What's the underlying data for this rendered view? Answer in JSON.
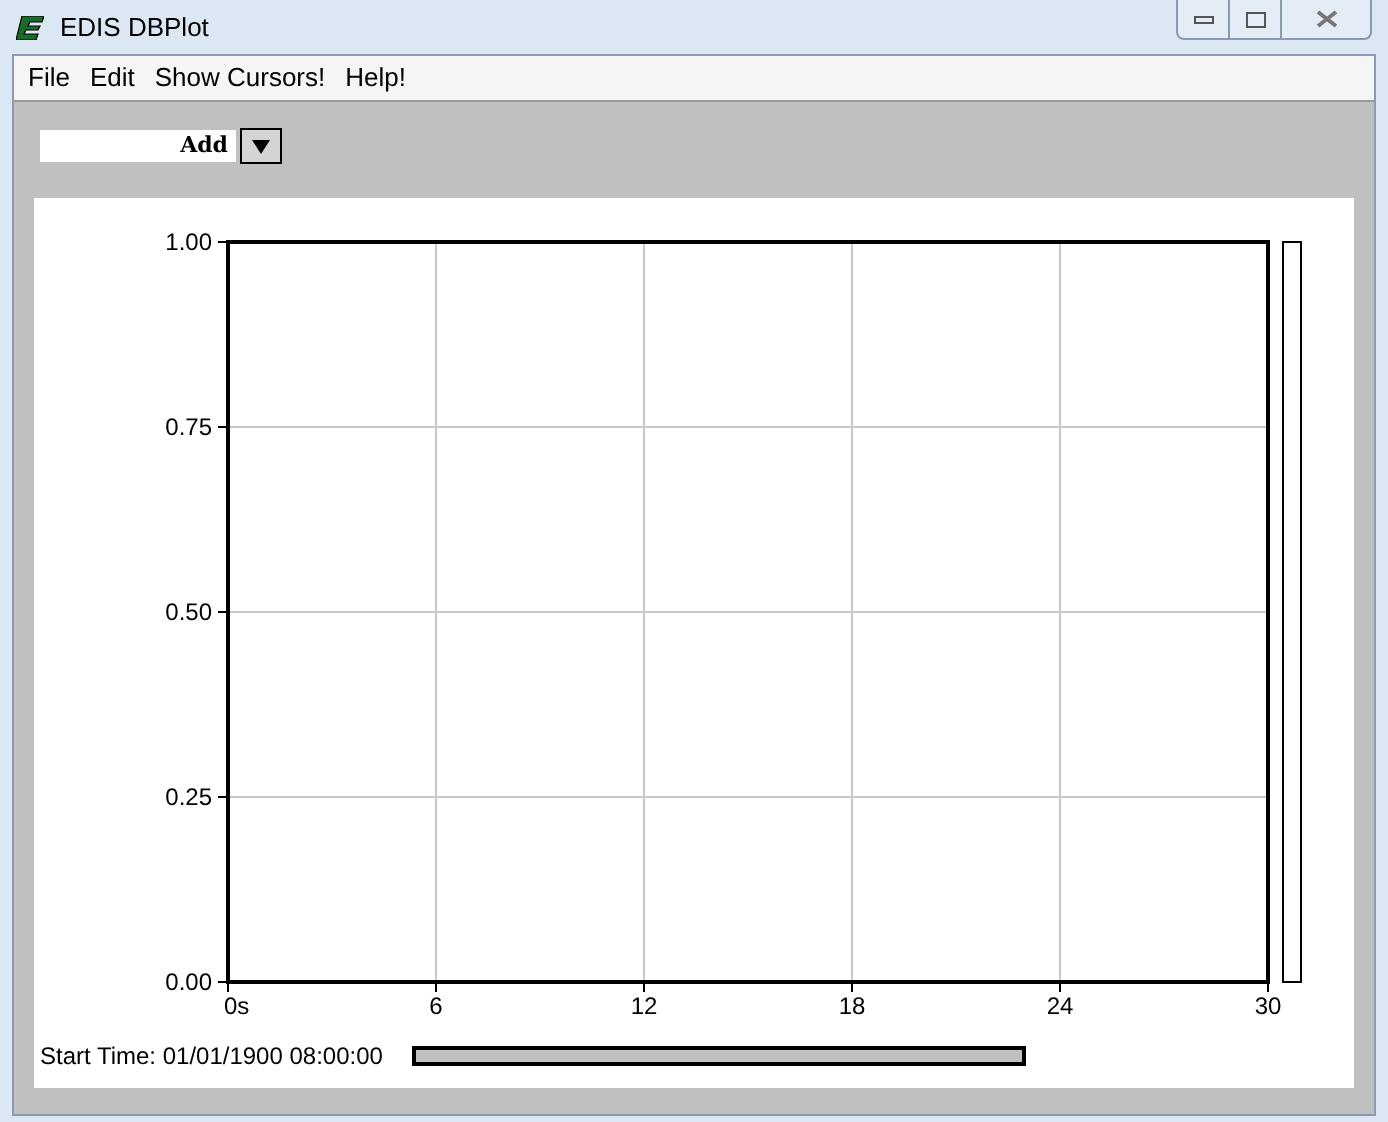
{
  "window": {
    "title": "EDIS DBPlot"
  },
  "menu": [
    {
      "label": "File"
    },
    {
      "label": "Edit"
    },
    {
      "label": "Show Cursors!"
    },
    {
      "label": "Help!"
    }
  ],
  "add_combo": {
    "value": "Add"
  },
  "plot": {
    "chart_data": {
      "type": "line",
      "grid": true,
      "xlim": [
        0,
        30
      ],
      "ylim": [
        0,
        1
      ],
      "xticks": [
        {
          "value": 0,
          "label": "0s"
        },
        {
          "value": 6,
          "label": "6"
        },
        {
          "value": 12,
          "label": "12"
        },
        {
          "value": 18,
          "label": "18"
        },
        {
          "value": 24,
          "label": "24"
        },
        {
          "value": 30,
          "label": "30"
        }
      ],
      "yticks": [
        {
          "value": 0,
          "label": "0.00"
        },
        {
          "value": 0.25,
          "label": "0.25"
        },
        {
          "value": 0.5,
          "label": "0.50"
        },
        {
          "value": 0.75,
          "label": "0.75"
        },
        {
          "value": 1,
          "label": "1.00"
        }
      ]
    }
  },
  "start_time": "Start Time: 01/01/1900 08:00:00"
}
